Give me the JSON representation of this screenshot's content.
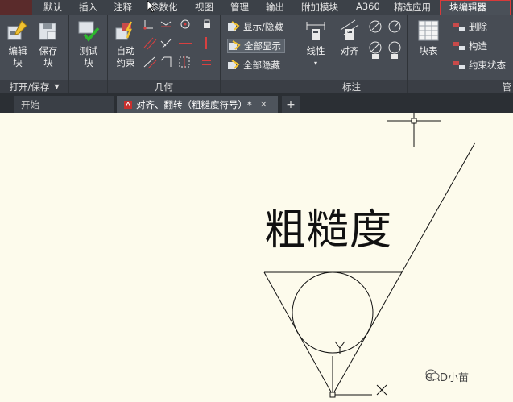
{
  "menu": {
    "tabs": [
      "默认",
      "插入",
      "注释",
      "参数化",
      "视图",
      "管理",
      "输出",
      "附加模块",
      "A360",
      "精选应用",
      "块编辑器"
    ],
    "active": "块编辑器"
  },
  "ribbon": {
    "open_save_panel": {
      "title": "打开/保存",
      "edit_block_label": "编辑\n块",
      "save_block_label": "保存\n块"
    },
    "test_block_label": "测试\n块",
    "auto_constrain_label": "自动\n约束",
    "geometry_panel_title": "几何",
    "visibility": {
      "show_hide": "显示/隐藏",
      "show_all": "全部显示",
      "hide_all": "全部隐藏"
    },
    "linear_label": "线性",
    "align_label": "对齐",
    "dimension_panel_title": "标注",
    "block_table_label": "块表",
    "manage": {
      "delete": "删除",
      "construct": "构造",
      "constraint_status": "约束状态",
      "panel_title": "管"
    }
  },
  "doc_tabs": {
    "start": "开始",
    "file": "对齐、翻转（粗糙度符号）*"
  },
  "canvas": {
    "label_text": "粗糙度",
    "ucs_y": "Y",
    "ucs_x": "X",
    "watermark": "CAD小苗"
  }
}
